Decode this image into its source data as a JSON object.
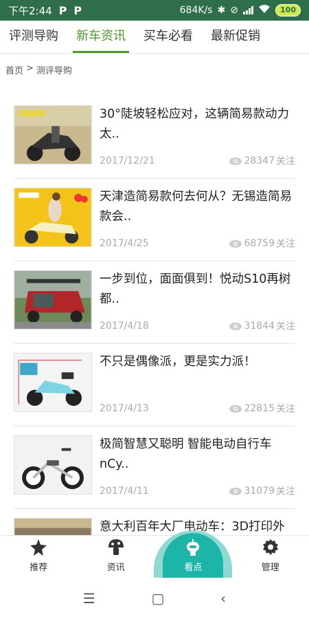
{
  "status_bar": {
    "time": "下午2:44",
    "notif1": "P",
    "notif2": "P",
    "speed": "684K/s",
    "battery": "100"
  },
  "tabs": [
    {
      "label": "评测导购",
      "active": false
    },
    {
      "label": "新车资讯",
      "active": true
    },
    {
      "label": "买车必看",
      "active": false
    },
    {
      "label": "最新促销",
      "active": false
    }
  ],
  "breadcrumb": {
    "home": "首页",
    "sep": ">",
    "current": "测评导购"
  },
  "articles": [
    {
      "title": "30°陡坡轻松应对，这辆简易款动力太..",
      "date": "2017/12/21",
      "views": "28347",
      "views_suffix": "关注"
    },
    {
      "title": "天津造简易款何去何从？无锡造简易款会..",
      "date": "2017/4/25",
      "views": "68759",
      "views_suffix": "关注"
    },
    {
      "title": "一步到位，面面俱到！悦动S10再树都..",
      "date": "2017/4/18",
      "views": "31844",
      "views_suffix": "关注"
    },
    {
      "title": "不只是偶像派，更是实力派！",
      "date": "2017/4/13",
      "views": "22815",
      "views_suffix": "关注"
    },
    {
      "title": "极简智慧又聪明 智能电动自行车nCy..",
      "date": "2017/4/11",
      "views": "31079",
      "views_suffix": "关注"
    },
    {
      "title": "意大利百年大厂电动车：3D打印外",
      "date": "",
      "views": "",
      "views_suffix": ""
    }
  ],
  "bottom_nav": [
    {
      "label": "推荐",
      "icon": "star-icon"
    },
    {
      "label": "资讯",
      "icon": "mushroom-icon"
    },
    {
      "label": "看点",
      "icon": "robot-icon",
      "active": true
    },
    {
      "label": "管理",
      "icon": "gear-icon"
    }
  ],
  "colors": {
    "status_bar": "#2e6e4b",
    "accent": "#4c9a2a",
    "active_nav": "#1db5a8"
  }
}
